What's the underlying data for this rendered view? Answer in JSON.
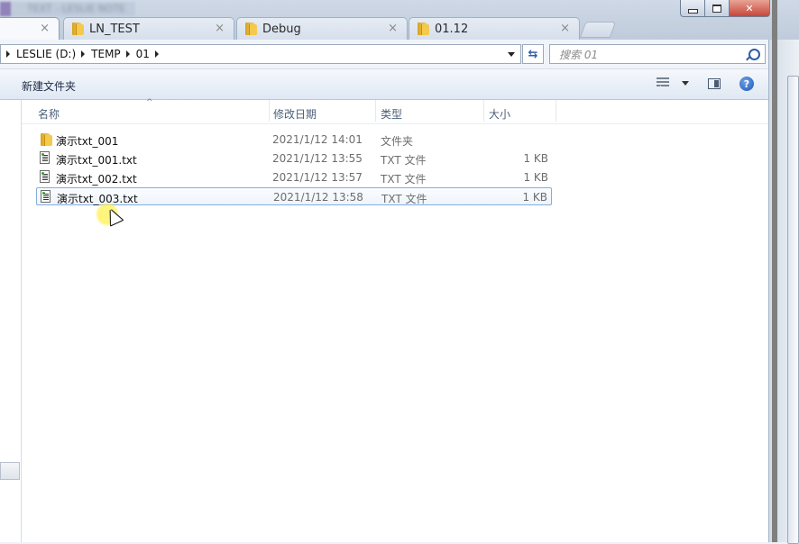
{
  "window": {
    "app_title_blurred": "TEXT - LESLIE NOTE",
    "controls": {
      "minimize": "—",
      "maximize": "□",
      "close": "✕"
    }
  },
  "tabs": [
    {
      "label": "",
      "close": "×",
      "active": true
    },
    {
      "label": "LN_TEST",
      "close": "×",
      "active": false
    },
    {
      "label": "Debug",
      "close": "×",
      "active": false
    },
    {
      "label": "01.12",
      "close": "×",
      "active": false
    }
  ],
  "address": {
    "crumbs": [
      "LESLIE (D:)",
      "TEMP",
      "01"
    ],
    "refresh_glyph": "⇆",
    "search_placeholder": "搜索 01"
  },
  "toolbar": {
    "new_folder": "新建文件夹",
    "view_icon": "details-view-icon",
    "preview_pane_icon": "preview-pane-icon",
    "help_icon": "help-icon",
    "help_glyph": "?"
  },
  "columns": {
    "name": "名称",
    "date": "修改日期",
    "type": "类型",
    "size": "大小",
    "sort_indicator": "^"
  },
  "files": [
    {
      "name": "演示txt_001",
      "date": "2021/1/12 14:01",
      "type": "文件夹",
      "size": "",
      "icon": "folder-icon",
      "selected": false
    },
    {
      "name": "演示txt_001.txt",
      "date": "2021/1/12 13:55",
      "type": "TXT 文件",
      "size": "1 KB",
      "icon": "txt-file-icon",
      "selected": false
    },
    {
      "name": "演示txt_002.txt",
      "date": "2021/1/12 13:57",
      "type": "TXT 文件",
      "size": "1 KB",
      "icon": "txt-file-icon",
      "selected": false
    },
    {
      "name": "演示txt_003.txt",
      "date": "2021/1/12 13:58",
      "type": "TXT 文件",
      "size": "1 KB",
      "icon": "txt-file-icon",
      "selected": true
    }
  ],
  "colors": {
    "selection_border": "#84acdd",
    "link_blue": "#2f5da8",
    "close_red": "#c7453a"
  }
}
